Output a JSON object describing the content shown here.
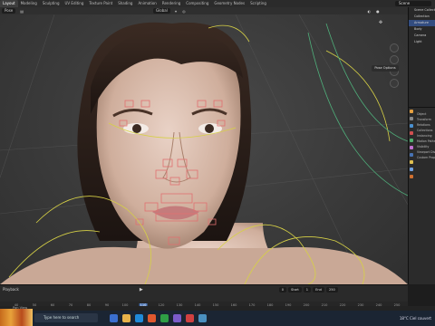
{
  "workspace_tabs": [
    "Layout",
    "Modeling",
    "Sculpting",
    "UV Editing",
    "Texture Paint",
    "Shading",
    "Animation",
    "Rendering",
    "Compositing",
    "Geometry Nodes",
    "Scripting"
  ],
  "active_tab": "Layout",
  "scene_name": "Scene",
  "header": {
    "mode": "Pose",
    "orientation": "Global"
  },
  "pose_options_label": "Pose Options",
  "outliner_rows": [
    "Scene Collection",
    "Collection",
    "Armature",
    "Body",
    "Camera",
    "Light"
  ],
  "properties_rows": [
    "Object",
    "Transform",
    "Relations",
    "Collections",
    "Instancing",
    "Motion Paths",
    "Visibility",
    "Viewport Display",
    "Custom Properties"
  ],
  "timeline": {
    "playback_label": "Playback",
    "current_frame": "0",
    "start_label": "Start",
    "start_value": "1",
    "end_label": "End",
    "end_value": "250",
    "ticks": [
      "40",
      "50",
      "60",
      "70",
      "80",
      "90",
      "100",
      "110",
      "120",
      "130",
      "140",
      "150",
      "160",
      "170",
      "180",
      "190",
      "200",
      "210",
      "220",
      "230",
      "240",
      "250"
    ],
    "current_frame_marker": "110"
  },
  "statusbar_text": "Pan View",
  "taskbar": {
    "search_placeholder": "Type here to search",
    "weather": "18°C  Ciel couvert"
  },
  "colors": {
    "bone_outline": "#e07070",
    "curve_yellow": "#d6d046",
    "accent_blue": "#4772b3"
  }
}
